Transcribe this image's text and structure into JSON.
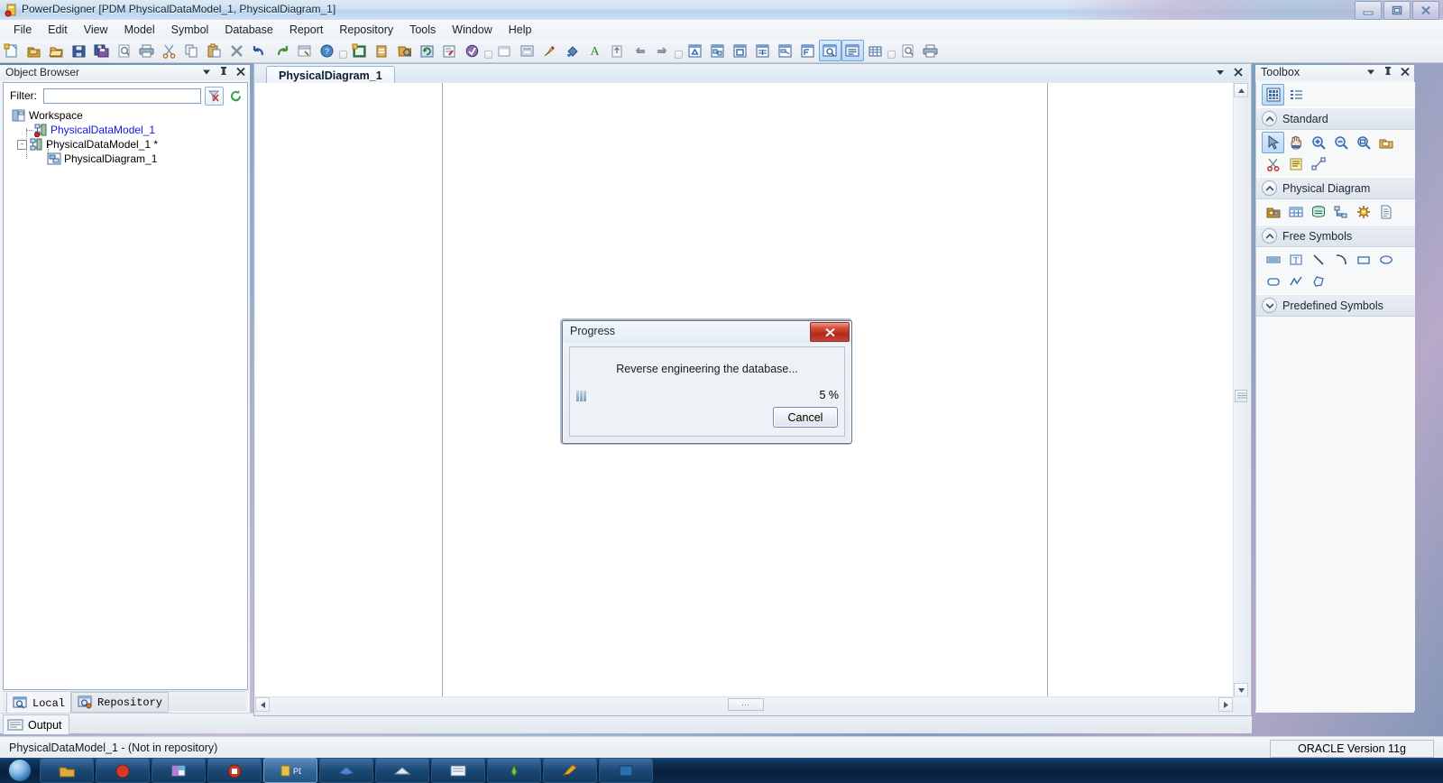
{
  "window": {
    "title": "PowerDesigner [PDM PhysicalDataModel_1, PhysicalDiagram_1]",
    "app_icon": "powerdesigner-icon",
    "minimize": "minimize-icon",
    "maximize": "restore-icon",
    "close": "close-icon"
  },
  "menu": {
    "items": [
      {
        "label": "File"
      },
      {
        "label": "Edit"
      },
      {
        "label": "View"
      },
      {
        "label": "Model"
      },
      {
        "label": "Symbol"
      },
      {
        "label": "Database"
      },
      {
        "label": "Report"
      },
      {
        "label": "Repository"
      },
      {
        "label": "Tools"
      },
      {
        "label": "Window"
      },
      {
        "label": "Help"
      }
    ]
  },
  "toolbar": {
    "groups": [
      {
        "buttons": [
          {
            "icon": "new-document-icon"
          },
          {
            "icon": "new-package-icon"
          },
          {
            "icon": "open-folder-icon"
          },
          {
            "icon": "save-icon"
          },
          {
            "icon": "save-all-icon"
          },
          {
            "icon": "print-preview-icon"
          },
          {
            "icon": "print-icon"
          },
          {
            "icon": "cut-icon"
          },
          {
            "icon": "copy-icon"
          },
          {
            "icon": "paste-icon"
          },
          {
            "icon": "delete-icon"
          },
          {
            "icon": "undo-icon"
          },
          {
            "icon": "redo-icon"
          },
          {
            "icon": "properties-icon"
          },
          {
            "icon": "help-icon"
          }
        ]
      },
      {
        "buttons": [
          {
            "icon": "new-model-icon"
          },
          {
            "icon": "new-report-icon"
          },
          {
            "icon": "generate-icon"
          },
          {
            "icon": "refresh-model-icon"
          },
          {
            "icon": "check-model-icon"
          },
          {
            "icon": "design-icon"
          }
        ]
      },
      {
        "buttons": [
          {
            "icon": "zoom-window-icon"
          },
          {
            "icon": "display-preferences-icon"
          },
          {
            "icon": "format-brush-icon"
          },
          {
            "icon": "fill-color-icon"
          },
          {
            "icon": "font-color-icon"
          },
          {
            "icon": "export-icon"
          },
          {
            "icon": "previous-icon"
          },
          {
            "icon": "next-icon"
          }
        ]
      },
      {
        "buttons": [
          {
            "icon": "view-cdm-icon"
          },
          {
            "icon": "view-ldm-icon"
          },
          {
            "icon": "view-pdm-icon"
          },
          {
            "icon": "view-table-icon"
          },
          {
            "icon": "view-oom-icon"
          },
          {
            "icon": "view-xsm-icon"
          },
          {
            "icon": "browser-toggle-icon",
            "selected": true
          },
          {
            "icon": "output-toggle-icon",
            "selected": true
          },
          {
            "icon": "result-list-icon"
          }
        ]
      },
      {
        "buttons": [
          {
            "icon": "page-setup-icon"
          },
          {
            "icon": "print-diagram-icon"
          }
        ]
      }
    ]
  },
  "object_browser": {
    "title": "Object Browser",
    "header_buttons": [
      {
        "icon": "dropdown-menu-icon"
      },
      {
        "icon": "pin-icon"
      },
      {
        "icon": "close-icon"
      }
    ],
    "filter": {
      "label": "Filter:",
      "value": "",
      "placeholder": "",
      "buttons": [
        {
          "icon": "apply-filter-icon",
          "framed": true
        },
        {
          "icon": "refresh-icon",
          "framed": false
        }
      ]
    },
    "tree": [
      {
        "label": "Workspace",
        "icon": "workspace-icon",
        "depth": 0,
        "link": false,
        "expander": ""
      },
      {
        "label": "PhysicalDataModel_1",
        "icon": "pdm-model-icon-shortcut",
        "depth": 1,
        "link": true,
        "expander": ""
      },
      {
        "label": "PhysicalDataModel_1 *",
        "icon": "pdm-model-icon",
        "depth": 1,
        "link": false,
        "expander": "-"
      },
      {
        "label": "PhysicalDiagram_1",
        "icon": "physical-diagram-icon",
        "depth": 2,
        "link": false,
        "expander": ""
      }
    ],
    "tabs": [
      {
        "label": "Local",
        "icon": "local-icon",
        "active": true
      },
      {
        "label": "Repository",
        "icon": "repository-icon",
        "active": false
      }
    ]
  },
  "output_panel": {
    "tab_label": "Output",
    "tab_icon": "output-icon"
  },
  "diagram": {
    "tabs": [
      {
        "label": "PhysicalDiagram_1",
        "active": true
      }
    ],
    "header_buttons": [
      {
        "icon": "dropdown-menu-icon"
      },
      {
        "icon": "close-icon"
      }
    ],
    "scroll": {
      "up_arrow": "scroll-up-icon",
      "down_arrow": "scroll-down-icon",
      "left_arrow": "scroll-left-icon",
      "right_arrow": "scroll-right-icon",
      "h_thumb_grip": "⋯"
    }
  },
  "toolbox": {
    "title": "Toolbox",
    "header_buttons": [
      {
        "icon": "dropdown-menu-icon"
      },
      {
        "icon": "pin-icon"
      },
      {
        "icon": "close-icon"
      }
    ],
    "top_row": [
      {
        "icon": "palette-grid-view-icon",
        "selected": true
      },
      {
        "icon": "palette-list-view-icon",
        "selected": false
      }
    ],
    "groups": [
      {
        "label": "Standard",
        "expanded": true,
        "chevron": "chevron-up-icon",
        "tools": [
          {
            "icon": "pointer-icon",
            "selected": true
          },
          {
            "icon": "grabber-hand-icon"
          },
          {
            "icon": "zoom-in-icon"
          },
          {
            "icon": "zoom-out-icon"
          },
          {
            "icon": "zoom-area-icon"
          },
          {
            "icon": "open-package-diagram-icon"
          },
          {
            "icon": "delete-scissors-icon"
          },
          {
            "icon": "note-icon"
          },
          {
            "icon": "link-note-icon"
          }
        ]
      },
      {
        "label": "Physical Diagram",
        "expanded": true,
        "chevron": "chevron-up-icon",
        "tools": [
          {
            "icon": "package-icon"
          },
          {
            "icon": "table-icon"
          },
          {
            "icon": "view-icon"
          },
          {
            "icon": "reference-icon"
          },
          {
            "icon": "procedure-icon"
          },
          {
            "icon": "file-object-icon"
          }
        ]
      },
      {
        "label": "Free Symbols",
        "expanded": true,
        "chevron": "chevron-up-icon",
        "tools": [
          {
            "icon": "title-symbol-icon"
          },
          {
            "icon": "text-symbol-icon"
          },
          {
            "icon": "line-symbol-icon"
          },
          {
            "icon": "arc-symbol-icon"
          },
          {
            "icon": "rectangle-symbol-icon"
          },
          {
            "icon": "ellipse-symbol-icon"
          },
          {
            "icon": "rounded-rectangle-symbol-icon"
          },
          {
            "icon": "polyline-symbol-icon"
          },
          {
            "icon": "polygon-symbol-icon"
          }
        ]
      },
      {
        "label": "Predefined Symbols",
        "expanded": false,
        "chevron": "chevron-down-icon",
        "tools": []
      }
    ]
  },
  "dialog": {
    "title": "Progress",
    "close_icon": "close-icon",
    "message": "Reverse engineering the database...",
    "percent_label": "5 %",
    "percent_value": 5,
    "cancel_label": "Cancel"
  },
  "status_bar": {
    "left_text": "PhysicalDataModel_1 - (Not in repository)",
    "right_text": "ORACLE Version 11g"
  },
  "taskbar": {
    "start_icon": "windows-start-orb",
    "buttons": [
      {
        "icon": "taskbar-item-1"
      },
      {
        "icon": "taskbar-item-2"
      },
      {
        "icon": "taskbar-item-3"
      },
      {
        "icon": "taskbar-item-4"
      },
      {
        "icon": "taskbar-item-5"
      },
      {
        "icon": "taskbar-item-6"
      },
      {
        "icon": "taskbar-item-7"
      },
      {
        "icon": "taskbar-item-8"
      },
      {
        "icon": "taskbar-item-9"
      },
      {
        "icon": "taskbar-item-10"
      },
      {
        "icon": "taskbar-item-11"
      }
    ]
  },
  "colors": {
    "accent_blue": "#bcd9f5",
    "link_blue": "#1414e0",
    "dialog_close_red": "#b2291a",
    "titlebar_top": "#dfeaf6"
  }
}
